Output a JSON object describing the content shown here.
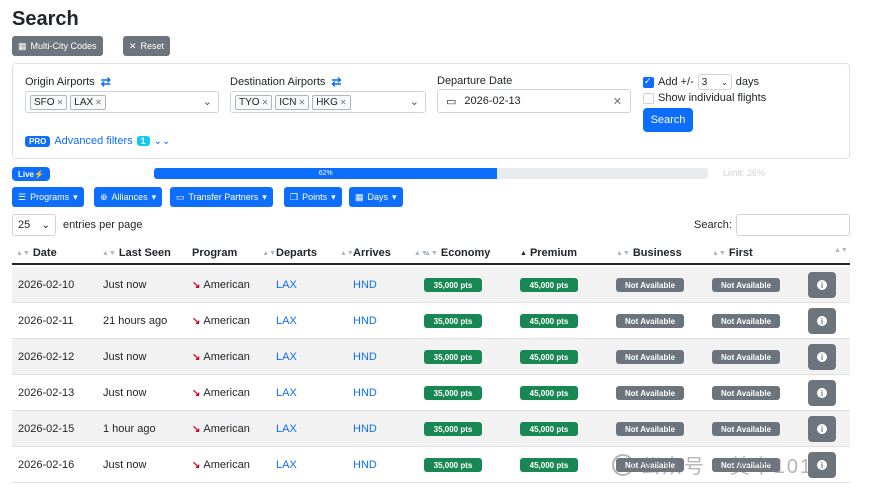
{
  "page": {
    "title": "Search"
  },
  "toolbar": {
    "multi_city": "Multi-City Codes",
    "reset": "Reset"
  },
  "search": {
    "origin_label": "Origin Airports",
    "origin_tags": [
      "SFO",
      "LAX"
    ],
    "destination_label": "Destination Airports",
    "destination_tags": [
      "TYO",
      "ICN",
      "HKG"
    ],
    "date_label": "Departure Date",
    "date_value": "2026-02-13",
    "add_label": "Add +/-",
    "add_value": "3",
    "days_label": "days",
    "show_individual": "Show individual flights",
    "search_button": "Search",
    "pro_badge": "PRO",
    "advanced_filters": "Advanced filters",
    "advanced_count": "1"
  },
  "status": {
    "live": "Live",
    "progress_text": "62%",
    "progress": 0.62,
    "limit": "Limit: 26%"
  },
  "filters": [
    "Programs",
    "Alliances",
    "Transfer Partners",
    "Points",
    "Days"
  ],
  "table_controls": {
    "page_size": "25",
    "entries_label": "entries per page",
    "search_label": "Search:"
  },
  "table": {
    "headers": [
      "Date",
      "Last Seen",
      "Program",
      "Departs",
      "Arrives",
      "Economy",
      "Premium",
      "Business",
      "First"
    ],
    "rows": [
      {
        "date": "2026-02-10",
        "last_seen": "Just now",
        "program": "American",
        "departs": "LAX",
        "arrives": "HND",
        "economy": "35,000 pts",
        "premium": "45,000 pts",
        "business": "Not Available",
        "first": "Not Available"
      },
      {
        "date": "2026-02-11",
        "last_seen": "21 hours ago",
        "program": "American",
        "departs": "LAX",
        "arrives": "HND",
        "economy": "35,000 pts",
        "premium": "45,000 pts",
        "business": "Not Available",
        "first": "Not Available"
      },
      {
        "date": "2026-02-12",
        "last_seen": "Just now",
        "program": "American",
        "departs": "LAX",
        "arrives": "HND",
        "economy": "35,000 pts",
        "premium": "45,000 pts",
        "business": "Not Available",
        "first": "Not Available"
      },
      {
        "date": "2026-02-13",
        "last_seen": "Just now",
        "program": "American",
        "departs": "LAX",
        "arrives": "HND",
        "economy": "35,000 pts",
        "premium": "45,000 pts",
        "business": "Not Available",
        "first": "Not Available"
      },
      {
        "date": "2026-02-15",
        "last_seen": "1 hour ago",
        "program": "American",
        "departs": "LAX",
        "arrives": "HND",
        "economy": "35,000 pts",
        "premium": "45,000 pts",
        "business": "Not Available",
        "first": "Not Available"
      },
      {
        "date": "2026-02-16",
        "last_seen": "Just now",
        "program": "American",
        "departs": "LAX",
        "arrives": "HND",
        "economy": "35,000 pts",
        "premium": "45,000 pts",
        "business": "Not Available",
        "first": "Not Available"
      }
    ]
  },
  "watermark": "公众号 · 美卡101",
  "colors": {
    "primary": "#0d6efd",
    "secondary": "#6c757d",
    "success": "#198754",
    "info": "#0dcaf0",
    "airline": "#d0021b"
  }
}
